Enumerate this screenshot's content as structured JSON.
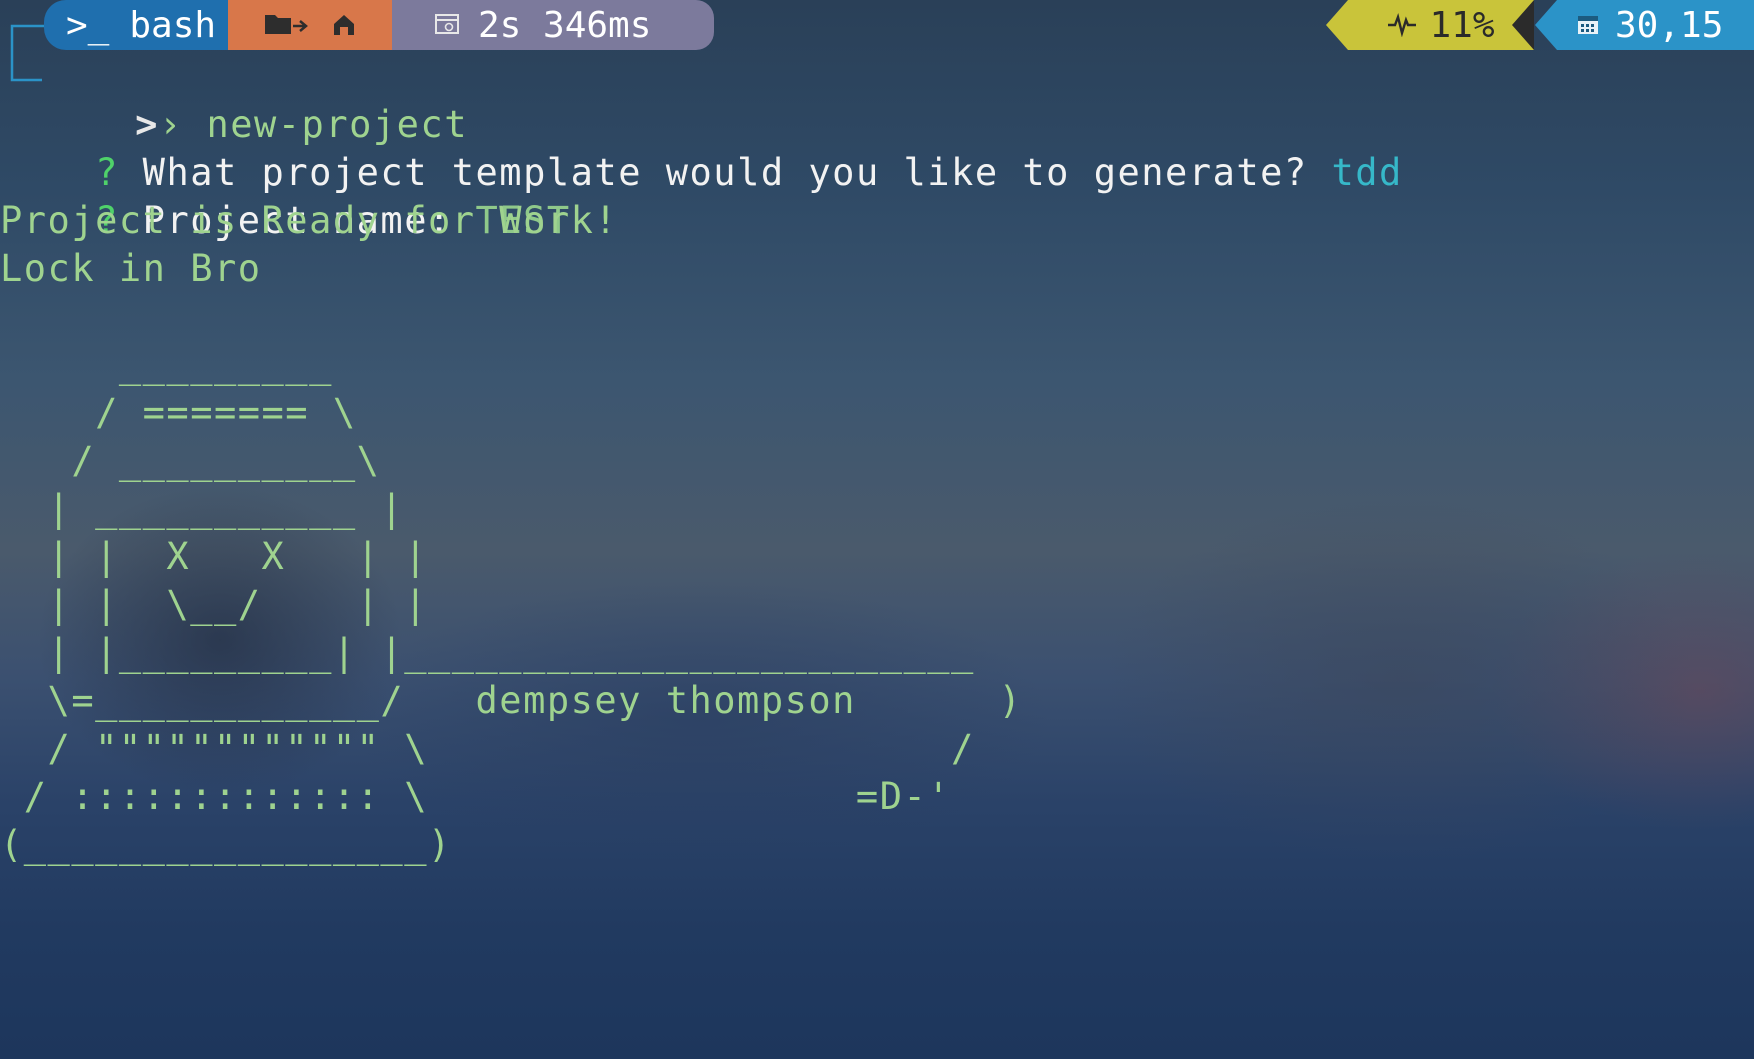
{
  "prompt_bar": {
    "shell_glyph": ">_",
    "shell_name": "bash",
    "exec_time": "2s 346ms",
    "cpu": "11%",
    "date": "30,15",
    "icons": [
      "terminal-icon",
      "folder-arrow-icon",
      "home-icon",
      "stopwatch-icon",
      "pulse-icon",
      "calendar-icon"
    ]
  },
  "prompt": {
    "arrow": ">",
    "chevron": "›",
    "command": "new-project"
  },
  "questions": [
    {
      "mark": "?",
      "label": "What project template would you like to generate?",
      "answer": "tdd"
    },
    {
      "mark": "?",
      "label": "Project name:",
      "answer": "TEST"
    }
  ],
  "messages": [
    "Project is Ready for Work!",
    "Lock in Bro"
  ],
  "ascii_art": [
    "     _________",
    "    / ======= \\",
    "   / __________\\",
    "  | ___________ |",
    "  | |  X   X   | |",
    "  | |  \\__/    | |",
    "  | |_________| |________________________",
    "  \\=____________/   dempsey thompson      )",
    "  / \"\"\"\"\"\"\"\"\"\"\"\" \\                      /",
    " / ::::::::::::: \\                  =D-'",
    "(_________________)"
  ]
}
